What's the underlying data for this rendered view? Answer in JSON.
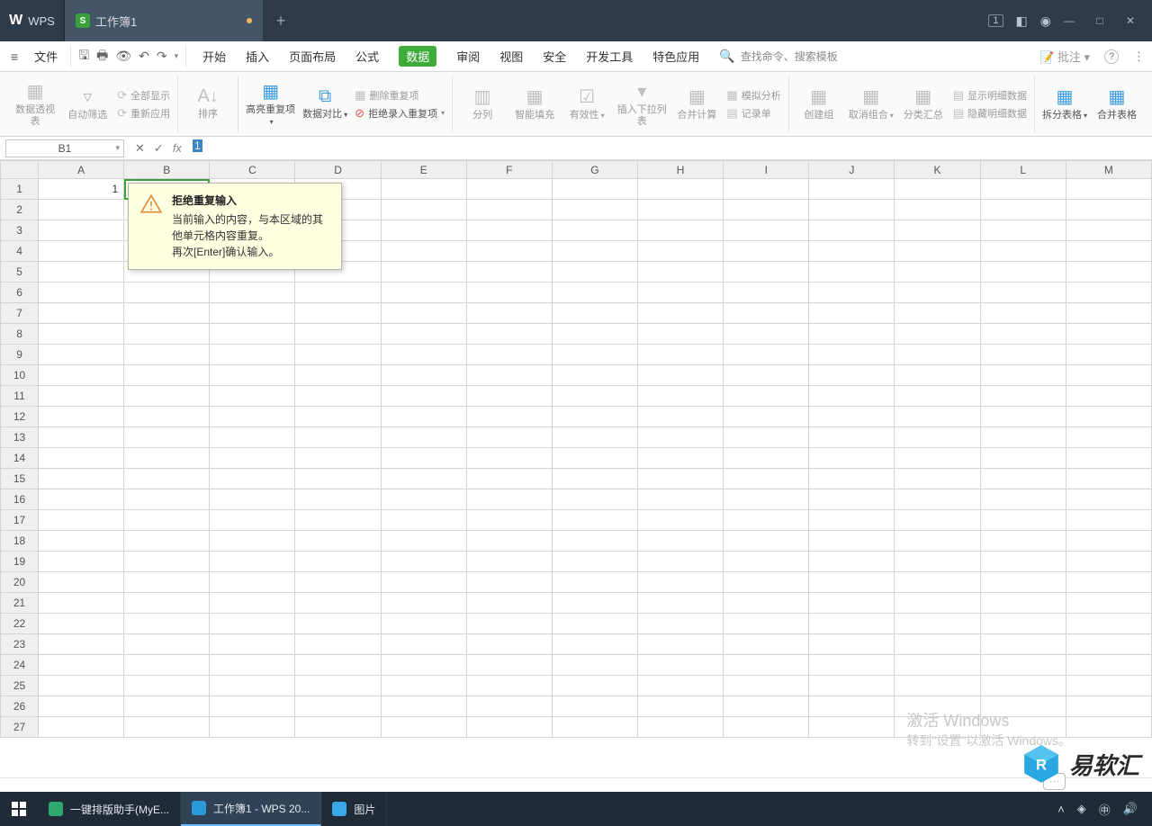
{
  "title": {
    "app": "WPS",
    "doc": "工作簿1",
    "new_tab_plus": "+",
    "right_badge": "1"
  },
  "win": {
    "min": "—",
    "max": "□",
    "close": "✕"
  },
  "menubar": {
    "file": "文件",
    "tabs": [
      "开始",
      "插入",
      "页面布局",
      "公式",
      "数据",
      "审阅",
      "视图",
      "安全",
      "开发工具",
      "特色应用"
    ],
    "active_index": 4,
    "search_placeholder": "查找命令、搜索模板",
    "approve": "批注",
    "help_q": "?"
  },
  "ribbon": {
    "g1": {
      "pivot": "数据透视表",
      "autofilter": "自动筛选",
      "showall": "全部显示",
      "reapply": "重新应用"
    },
    "g2": {
      "sort": "排序"
    },
    "g3": {
      "highlight_dup": "高亮重复项",
      "compare": "数据对比",
      "del_dup": "删除重复项",
      "reject_dup": "拒绝录入重复项"
    },
    "g4": {
      "split_col": "分列",
      "smart_fill": "智能填充",
      "validity": "有效性",
      "insert_dropdown": "插入下拉列表",
      "consolidate": "合并计算",
      "record": "记录单",
      "sim_analysis": "模拟分析"
    },
    "g5": {
      "create_group": "创建组",
      "ungroup": "取消组合",
      "subtotal": "分类汇总",
      "show_detail": "显示明细数据",
      "hide_detail": "隐藏明细数据"
    },
    "g6": {
      "split_table": "拆分表格",
      "merge_table": "合并表格"
    }
  },
  "formula_bar": {
    "cell_ref": "B1",
    "cancel": "✕",
    "confirm": "✓",
    "fx": "fx",
    "value": "1"
  },
  "grid": {
    "cols": [
      "A",
      "B",
      "C",
      "D",
      "E",
      "F",
      "G",
      "H",
      "I",
      "J",
      "K",
      "L",
      "M"
    ],
    "rows": 27,
    "cells": {
      "A1": "1",
      "B1_editing": "1"
    }
  },
  "popover": {
    "title": "拒绝重复输入",
    "line1": "当前输入的内容，与本区域的其他单元格内容重复。",
    "line2": "再次[Enter]确认输入。"
  },
  "watermark": {
    "l1": "激活 Windows",
    "l2": "转到\"设置\"以激活 Windows。"
  },
  "brand": "易软汇",
  "taskbar": {
    "items": [
      {
        "label": "一键排版助手(MyE...",
        "color": "#2fa870"
      },
      {
        "label": "工作簿1 - WPS 20...",
        "color": "#2c9ad6",
        "active": true
      },
      {
        "label": "图片",
        "color": "#3aa7e8"
      }
    ]
  }
}
